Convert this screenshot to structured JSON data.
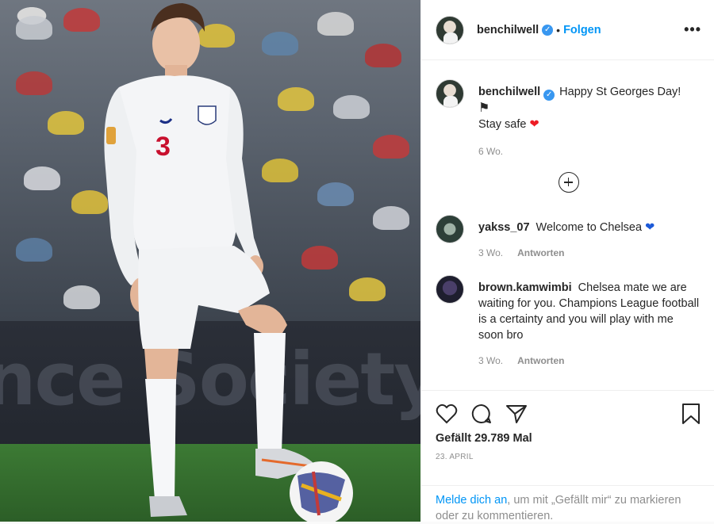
{
  "post": {
    "username": "benchilwell",
    "follow_label": "Folgen",
    "separator": "•",
    "more_label": "•••"
  },
  "caption": {
    "username": "benchilwell",
    "text_line1": "Happy St Georges Day!",
    "text_line2": "Stay safe",
    "time": "6 Wo."
  },
  "comments": [
    {
      "username": "yakss_07",
      "text": "Welcome to Chelsea",
      "time": "3 Wo.",
      "reply_label": "Antworten"
    },
    {
      "username": "brown.kamwimbi",
      "text": "Chelsea mate we are waiting for you. Champions League football is a certainty and you will play with me soon bro",
      "time": "3 Wo.",
      "reply_label": "Antworten"
    }
  ],
  "engagement": {
    "likes": "Gefällt 29.789 Mal",
    "date": "23. APRIL"
  },
  "login_prompt": {
    "link": "Melde dich an",
    "rest": ", um mit „Gefällt mir“ zu markieren oder zu kommentieren."
  },
  "photo": {
    "jersey_number": "3",
    "banner_text": "nce Society"
  },
  "colors": {
    "link_blue": "#0095f6",
    "verified_blue": "#3897f0",
    "heart_red": "#ed1c24",
    "heart_blue": "#1d5ad8"
  }
}
